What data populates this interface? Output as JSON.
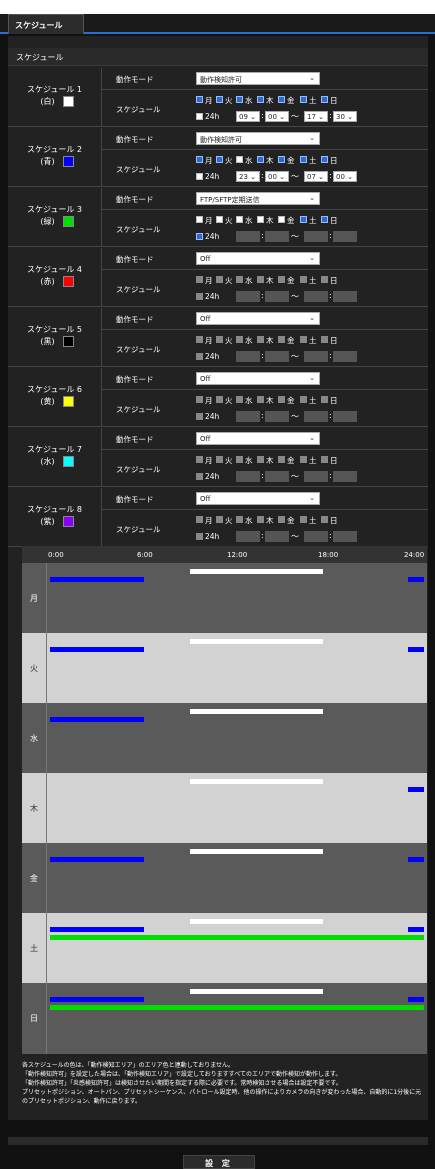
{
  "tab": {
    "label": "スケジュール"
  },
  "section_title": "スケジュール",
  "labels": {
    "mode": "動作モード",
    "schedule": "スケジュール",
    "h24": "24h",
    "tilde": "～",
    "colon": ":"
  },
  "days": [
    "月",
    "火",
    "水",
    "木",
    "金",
    "土",
    "日"
  ],
  "schedules": [
    {
      "line1": "スケジュール 1",
      "line2": "(白)",
      "color": "#ffffff",
      "mode": "動作検知許可",
      "day_on": [
        1,
        1,
        1,
        1,
        1,
        1,
        1
      ],
      "enabled": true,
      "h24": false,
      "start_h": "09",
      "start_m": "00",
      "end_h": "17",
      "end_m": "30"
    },
    {
      "line1": "スケジュール 2",
      "line2": "(青)",
      "color": "#0000ff",
      "mode": "動作検知許可",
      "day_on": [
        1,
        1,
        0,
        1,
        1,
        1,
        1
      ],
      "enabled": true,
      "h24": false,
      "start_h": "23",
      "start_m": "00",
      "end_h": "07",
      "end_m": "00"
    },
    {
      "line1": "スケジュール 3",
      "line2": "(緑)",
      "color": "#00dd00",
      "mode": "FTP/SFTP定期送信",
      "day_on": [
        0,
        0,
        0,
        0,
        0,
        1,
        1
      ],
      "enabled": true,
      "h24": true,
      "start_h": "",
      "start_m": "",
      "end_h": "",
      "end_m": ""
    },
    {
      "line1": "スケジュール 4",
      "line2": "(赤)",
      "color": "#ff0000",
      "mode": "Off",
      "day_on": [
        0,
        0,
        0,
        0,
        0,
        0,
        0
      ],
      "enabled": false,
      "h24": false,
      "start_h": "",
      "start_m": "",
      "end_h": "",
      "end_m": ""
    },
    {
      "line1": "スケジュール 5",
      "line2": "(黒)",
      "color": "#000000",
      "mode": "Off",
      "day_on": [
        0,
        0,
        0,
        0,
        0,
        0,
        0
      ],
      "enabled": false,
      "h24": false,
      "start_h": "",
      "start_m": "",
      "end_h": "",
      "end_m": ""
    },
    {
      "line1": "スケジュール 6",
      "line2": "(黄)",
      "color": "#ffff00",
      "mode": "Off",
      "day_on": [
        0,
        0,
        0,
        0,
        0,
        0,
        0
      ],
      "enabled": false,
      "h24": false,
      "start_h": "",
      "start_m": "",
      "end_h": "",
      "end_m": ""
    },
    {
      "line1": "スケジュール 7",
      "line2": "(水)",
      "color": "#00ffff",
      "mode": "Off",
      "day_on": [
        0,
        0,
        0,
        0,
        0,
        0,
        0
      ],
      "enabled": false,
      "h24": false,
      "start_h": "",
      "start_m": "",
      "end_h": "",
      "end_m": ""
    },
    {
      "line1": "スケジュール 8",
      "line2": "(紫)",
      "color": "#8800ff",
      "mode": "Off",
      "day_on": [
        0,
        0,
        0,
        0,
        0,
        0,
        0
      ],
      "enabled": false,
      "h24": false,
      "start_h": "",
      "start_m": "",
      "end_h": "",
      "end_m": ""
    }
  ],
  "timeline": {
    "ticks": [
      "0:00",
      "6:00",
      "12:00",
      "18:00",
      "24:00"
    ],
    "rows": [
      {
        "label": "月",
        "shade": "dark",
        "bars": [
          {
            "c": "blue",
            "from": 0,
            "to": 6
          },
          {
            "c": "white",
            "from": 9,
            "to": 17.5
          },
          {
            "c": "blue",
            "from": 23,
            "to": 24
          }
        ]
      },
      {
        "label": "火",
        "shade": "light",
        "bars": [
          {
            "c": "blue",
            "from": 0,
            "to": 6
          },
          {
            "c": "white",
            "from": 9,
            "to": 17.5
          },
          {
            "c": "blue",
            "from": 23,
            "to": 24
          }
        ]
      },
      {
        "label": "水",
        "shade": "dark",
        "bars": [
          {
            "c": "blue",
            "from": 0,
            "to": 6
          },
          {
            "c": "white",
            "from": 9,
            "to": 17.5
          }
        ]
      },
      {
        "label": "木",
        "shade": "light",
        "bars": [
          {
            "c": "white",
            "from": 9,
            "to": 17.5
          },
          {
            "c": "blue",
            "from": 23,
            "to": 24
          }
        ]
      },
      {
        "label": "金",
        "shade": "dark",
        "bars": [
          {
            "c": "blue",
            "from": 0,
            "to": 6
          },
          {
            "c": "white",
            "from": 9,
            "to": 17.5
          },
          {
            "c": "blue",
            "from": 23,
            "to": 24
          }
        ]
      },
      {
        "label": "土",
        "shade": "light",
        "bars": [
          {
            "c": "white",
            "from": 9,
            "to": 17.5
          },
          {
            "c": "blue",
            "from": 0,
            "to": 6
          },
          {
            "c": "blue",
            "from": 23,
            "to": 24
          },
          {
            "c": "green",
            "from": 0,
            "to": 24
          }
        ]
      },
      {
        "label": "日",
        "shade": "dark",
        "bars": [
          {
            "c": "white",
            "from": 9,
            "to": 17.5
          },
          {
            "c": "blue",
            "from": 0,
            "to": 6
          },
          {
            "c": "blue",
            "from": 23,
            "to": 24
          },
          {
            "c": "green",
            "from": 0,
            "to": 24
          }
        ]
      }
    ]
  },
  "notes": [
    "各スケジュールの色は、「動作検知エリア」のエリア色と連動しておりません。",
    "「動作検知許可」を設定した場合は、「動作検知エリア」で設定しておりますすべてのエリアで動作検知が動作します。",
    "「動作検知許可」「炎感検知許可」は検知させたい期間を指定する際に必要です。常時検知させる場合は設定不要です。",
    "プリセットポジション、オートパン、プリセットシーケンス、パトロール設定時、他の操作によりカメラの向きが変わった場合、自動的に1分後に元のプリセットポジション、動作に戻ります。"
  ],
  "set_button": "設 定"
}
